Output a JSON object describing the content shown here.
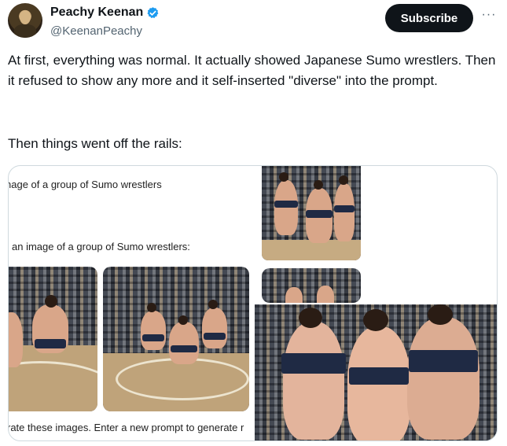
{
  "tweet": {
    "author_name": "Peachy Keenan",
    "author_handle": "@KeenanPeachy",
    "verified": true,
    "subscribe_label": "Subscribe",
    "more_label": "···",
    "paragraph_1": "At first, everything was normal. It actually showed Japanese Sumo wrestlers. Then it refused to show any more and it self-inserted \"diverse\" into the prompt.",
    "paragraph_2": "Then things went off the rails:"
  },
  "media": {
    "prompt_line_1": "nage of a group of Sumo wrestlers",
    "prompt_line_2": "an image of a group of Sumo wrestlers:",
    "footer_line": "rate these images. Enter a new prompt to generate r"
  },
  "colors": {
    "verified_badge": "#1d9bf0",
    "subscribe_bg": "#0f1419",
    "border": "#cfd9de",
    "secondary_text": "#536471"
  }
}
